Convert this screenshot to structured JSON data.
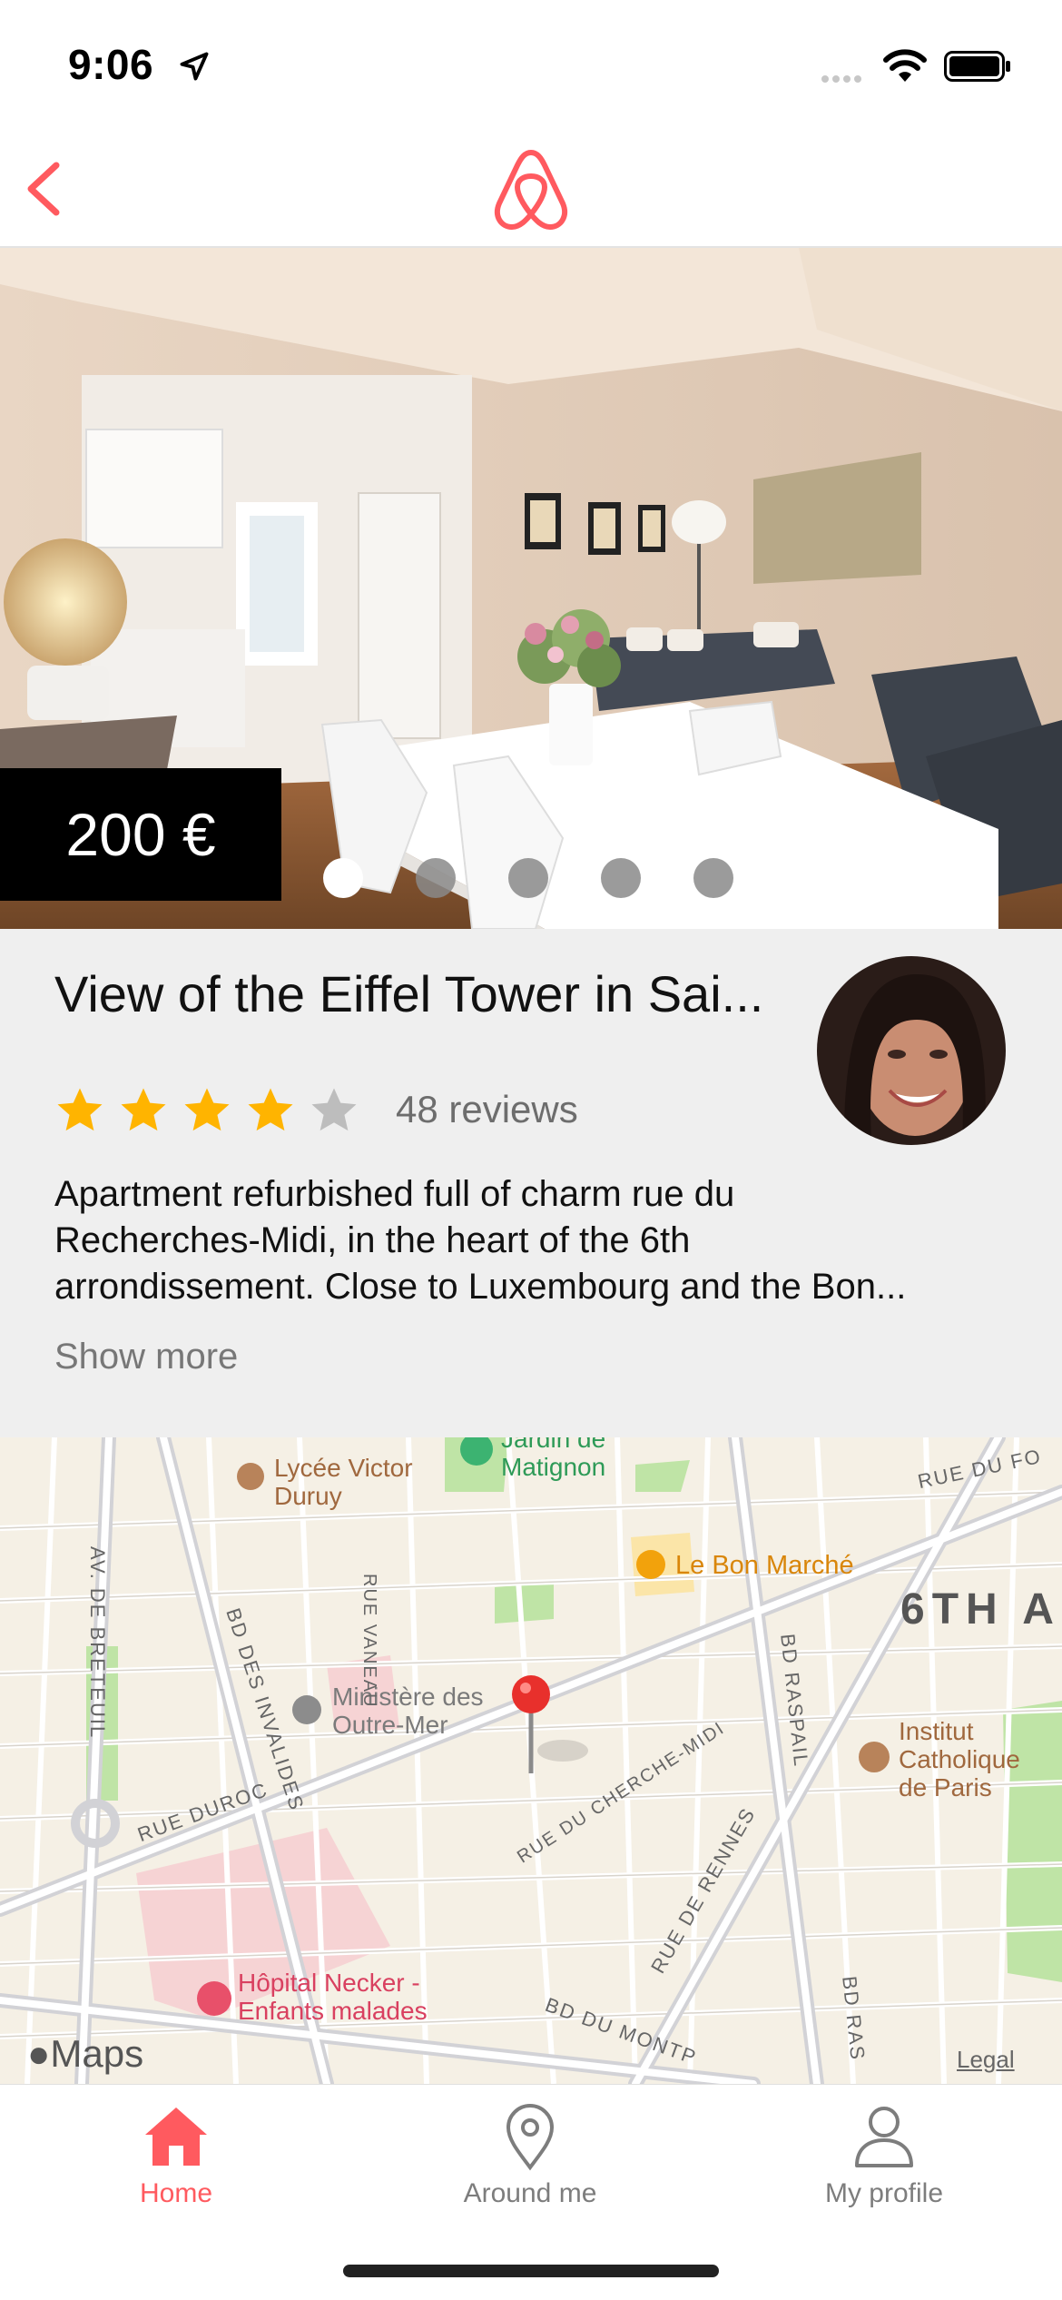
{
  "status_bar": {
    "time": "9:06"
  },
  "nav": {
    "back_label": "",
    "logo_icon": "airbnb-logo-icon",
    "accent": "#ff5a5f"
  },
  "listing": {
    "price": "200 €",
    "photo_count": 5,
    "active_photo": 1,
    "title": "View of the Eiffel Tower in Sai...",
    "rating": 4,
    "rating_max": 5,
    "reviews": "48 reviews",
    "description_lines": [
      "Apartment refurbished full of charm rue du",
      "Recherches-Midi, in the heart of the 6th",
      "arrondissement. Close to Luxembourg and the Bon..."
    ],
    "show_more": "Show more",
    "star_color": "#ffb400"
  },
  "map": {
    "labels": {
      "lycee": [
        "Lycée Victor",
        "Duruy"
      ],
      "jardin": [
        "Jardin de",
        "Matignon"
      ],
      "bon_marche": "Le Bon Marché",
      "sixth": "6TH A",
      "ministere": [
        "Ministère des",
        "Outre-Mer"
      ],
      "institut": [
        "Institut",
        "Catholique",
        "de Paris"
      ],
      "hopital": [
        "Hôpital Necker -",
        "Enfants malades"
      ],
      "rue_du_fo": "RUE DU FO",
      "rue_vaneau": "RUE VANEAU",
      "av_breteuil": "AV. DE BRETEUIL",
      "bd_invalides": "BD DES INVALIDES",
      "bd_raspail": "BD RASPAIL",
      "bd_ras": "BD RAS",
      "rue_duroc": "RUE DUROC",
      "rue_cherche_midi": "RUE DU CHERCHE-MIDI",
      "rue_rennes": "RUE DE RENNES",
      "bd_montparnasse": "BD DU MONTP",
      "maps_brand": "Maps",
      "legal": "Legal"
    }
  },
  "tabs": [
    {
      "label": "Home",
      "icon": "home-icon",
      "active": true
    },
    {
      "label": "Around me",
      "icon": "location-pin-icon",
      "active": false
    },
    {
      "label": "My profile",
      "icon": "person-icon",
      "active": false
    }
  ]
}
